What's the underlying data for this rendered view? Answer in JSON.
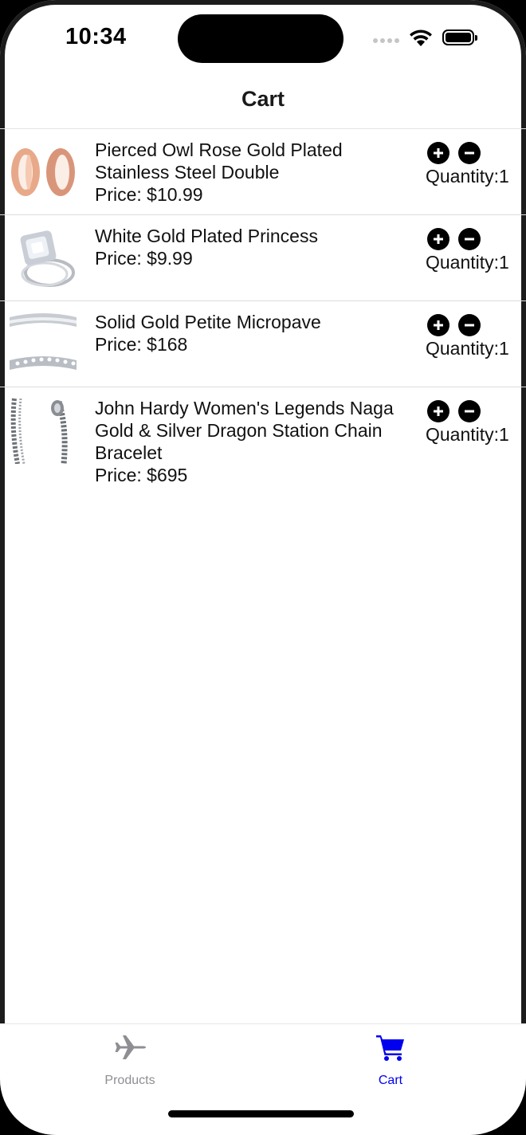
{
  "status_bar": {
    "time": "10:34"
  },
  "nav": {
    "title": "Cart"
  },
  "items": [
    {
      "name": "Pierced Owl Rose Gold Plated Stainless Steel Double",
      "price": "Price: $10.99",
      "quantity": "Quantity:1",
      "thumb_icon": "rose-gold-rings-image"
    },
    {
      "name": "White Gold Plated Princess",
      "price": "Price: $9.99",
      "quantity": "Quantity:1",
      "thumb_icon": "princess-ring-image"
    },
    {
      "name": "Solid Gold Petite Micropave",
      "price": "Price: $168",
      "quantity": "Quantity:1",
      "thumb_icon": "micropave-band-image"
    },
    {
      "name": "John Hardy Women's Legends Naga Gold & Silver Dragon Station Chain Bracelet",
      "price": "Price: $695",
      "quantity": "Quantity:1",
      "thumb_icon": "chain-bracelet-image"
    }
  ],
  "tabs": [
    {
      "label": "Products",
      "icon": "airplane-icon",
      "color": "#8e8e93"
    },
    {
      "label": "Cart",
      "icon": "cart-icon",
      "color": "#0000ee"
    }
  ]
}
